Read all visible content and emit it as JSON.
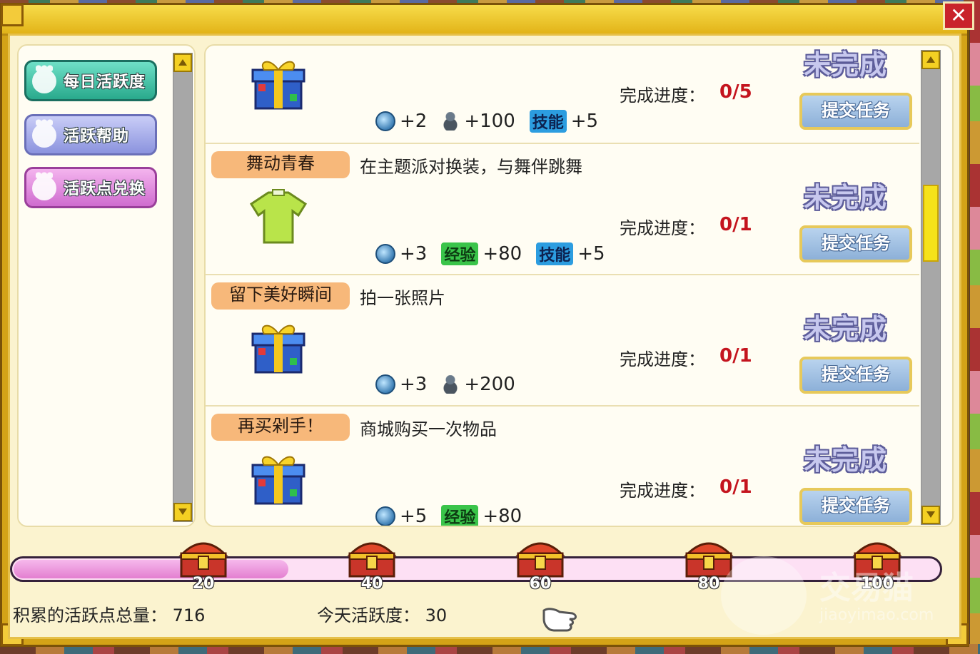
{
  "window": {
    "close_label": "✕"
  },
  "menu": [
    {
      "label": "每日活跃度"
    },
    {
      "label": "活跃帮助"
    },
    {
      "label": "活跃点兑换"
    }
  ],
  "tasks": [
    {
      "tag": "",
      "description": "",
      "icon": "gift-box-icon",
      "progress_label": "完成进度：",
      "progress": "0/5",
      "status": "未完成",
      "submit_label": "提交任务",
      "rewards": [
        {
          "icon": "coin-icon",
          "label": "",
          "amount": "+2"
        },
        {
          "icon": "money-bag-icon",
          "label": "",
          "amount": "+100"
        },
        {
          "icon": "skill-badge",
          "label": "技能",
          "amount": "+5"
        }
      ]
    },
    {
      "tag": "舞动青春",
      "description": "在主题派对换装，与舞伴跳舞",
      "icon": "green-shirt-icon",
      "progress_label": "完成进度：",
      "progress": "0/1",
      "status": "未完成",
      "submit_label": "提交任务",
      "rewards": [
        {
          "icon": "coin-icon",
          "label": "",
          "amount": "+3"
        },
        {
          "icon": "exp-badge",
          "label": "经验",
          "amount": "+80"
        },
        {
          "icon": "skill-badge",
          "label": "技能",
          "amount": "+5"
        }
      ]
    },
    {
      "tag": "留下美好瞬间",
      "description": "拍一张照片",
      "icon": "gift-box-icon",
      "progress_label": "完成进度：",
      "progress": "0/1",
      "status": "未完成",
      "submit_label": "提交任务",
      "rewards": [
        {
          "icon": "coin-icon",
          "label": "",
          "amount": "+3"
        },
        {
          "icon": "money-bag-icon",
          "label": "",
          "amount": "+200"
        }
      ]
    },
    {
      "tag": "再买剁手！",
      "description": "商城购买一次物品",
      "icon": "gift-box-icon",
      "progress_label": "完成进度：",
      "progress": "0/1",
      "status": "未完成",
      "submit_label": "提交任务",
      "rewards": [
        {
          "icon": "coin-icon",
          "label": "",
          "amount": "+5"
        },
        {
          "icon": "exp-badge",
          "label": "经验",
          "amount": "+80"
        }
      ]
    }
  ],
  "activity_bar": {
    "current": 30,
    "max": 100,
    "milestones": [
      "20",
      "40",
      "60",
      "80",
      "100"
    ]
  },
  "footer": {
    "total_label": "积累的活跃点总量：",
    "total_value": "716",
    "today_label": "今天活跃度：",
    "today_value": "30"
  },
  "watermark": {
    "title": "交易猫",
    "subtitle": "jiaoyimao.com"
  },
  "colors": {
    "frame": "#d4a317",
    "progress_red": "#c4141e",
    "bar_fill": "#e37fd0",
    "status_text": "#c7c8ee"
  }
}
